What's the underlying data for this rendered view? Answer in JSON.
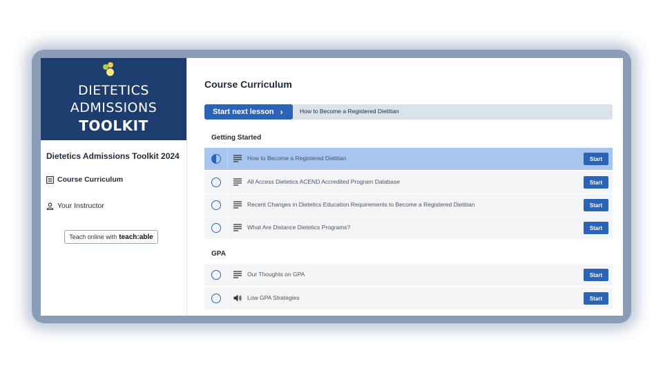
{
  "brand": {
    "line1": "DIETETICS",
    "line2": "ADMISSIONS",
    "line3": "TOOLKIT",
    "colors": {
      "background": "#1c3d6e",
      "dot1": "#a8cf45",
      "dot2": "#f2c94c",
      "dot3": "#f4e68a"
    }
  },
  "sidebar": {
    "course_title": "Dietetics Admissions Toolkit 2024",
    "items": [
      {
        "label": "Course Curriculum",
        "icon": "curriculum-icon"
      },
      {
        "label": "Your Instructor",
        "icon": "user-icon"
      }
    ],
    "teach_prefix": "Teach online with",
    "teach_logo": "teach:able"
  },
  "main": {
    "title": "Course Curriculum",
    "next_button": "Start next lesson",
    "next_lesson": "How to Become a Registered Dietitian",
    "sections": [
      {
        "title": "Getting Started",
        "lessons": [
          {
            "title": "How to Become a Registered Dietitian",
            "type": "text-icon",
            "status": "in-progress",
            "button": "Start"
          },
          {
            "title": "All Access Dietetics ACEND Accredited Program Database",
            "type": "text-icon",
            "status": "not-started",
            "button": "Start"
          },
          {
            "title": "Recent Changes in Dietetics Education Requirements to Become a Registered Dietitian",
            "type": "text-icon",
            "status": "not-started",
            "button": "Start"
          },
          {
            "title": "What Are Distance Dietetics Programs?",
            "type": "text-icon",
            "status": "not-started",
            "button": "Start"
          }
        ]
      },
      {
        "title": "GPA",
        "lessons": [
          {
            "title": "Our Thoughts on GPA",
            "type": "text-icon",
            "status": "not-started",
            "button": "Start"
          },
          {
            "title": "Low GPA Strategies",
            "type": "audio-icon",
            "status": "not-started",
            "button": "Start"
          }
        ]
      }
    ],
    "colors": {
      "accent": "#2b63b7",
      "active_row": "#a8c5ee"
    }
  }
}
